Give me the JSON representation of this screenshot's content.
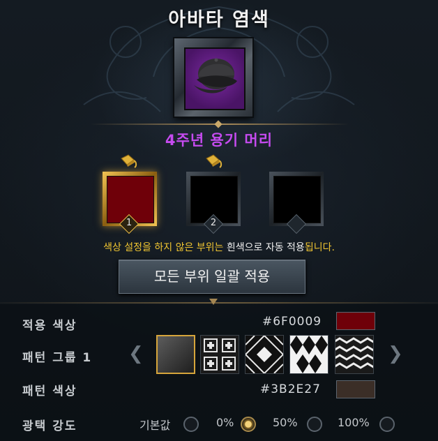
{
  "title": "아바타 염색",
  "item": {
    "name": "4주년 용기 머리",
    "icon": "cap-icon"
  },
  "slots": [
    {
      "number": "1",
      "active": true,
      "color": "#6F0009",
      "has_bucket": true
    },
    {
      "number": "2",
      "active": false,
      "color": "#000000",
      "has_bucket": true
    },
    {
      "number": "",
      "active": false,
      "color": "#000000",
      "has_bucket": false
    }
  ],
  "notice": {
    "part1": "색상 설정을 하지 않은 부위는 ",
    "part2": "흰색으로 자동 적용",
    "part3": "됩니다."
  },
  "apply_all_button": "모든 부위 일괄 적용",
  "settings": {
    "apply_color": {
      "label": "적용 색상",
      "hex": "#6F0009",
      "color": "#6F0009"
    },
    "pattern_group": {
      "label": "패턴 그룹 1",
      "selected_index": 0,
      "patterns": [
        "solid",
        "tile-cross",
        "diamond-lattice",
        "argyle",
        "wave"
      ]
    },
    "pattern_color": {
      "label": "패턴 색상",
      "hex": "#3B2E27",
      "color": "#3B2E27"
    },
    "gloss": {
      "label": "광택 강도",
      "options": [
        {
          "label": "기본값",
          "checked": false
        },
        {
          "label": "0%",
          "checked": true
        },
        {
          "label": "50%",
          "checked": false
        },
        {
          "label": "100%",
          "checked": false
        }
      ]
    }
  },
  "colors": {
    "accent_gold": "#f0c531",
    "item_name": "#c64bf0",
    "slot_active_border": "#f3c453"
  }
}
